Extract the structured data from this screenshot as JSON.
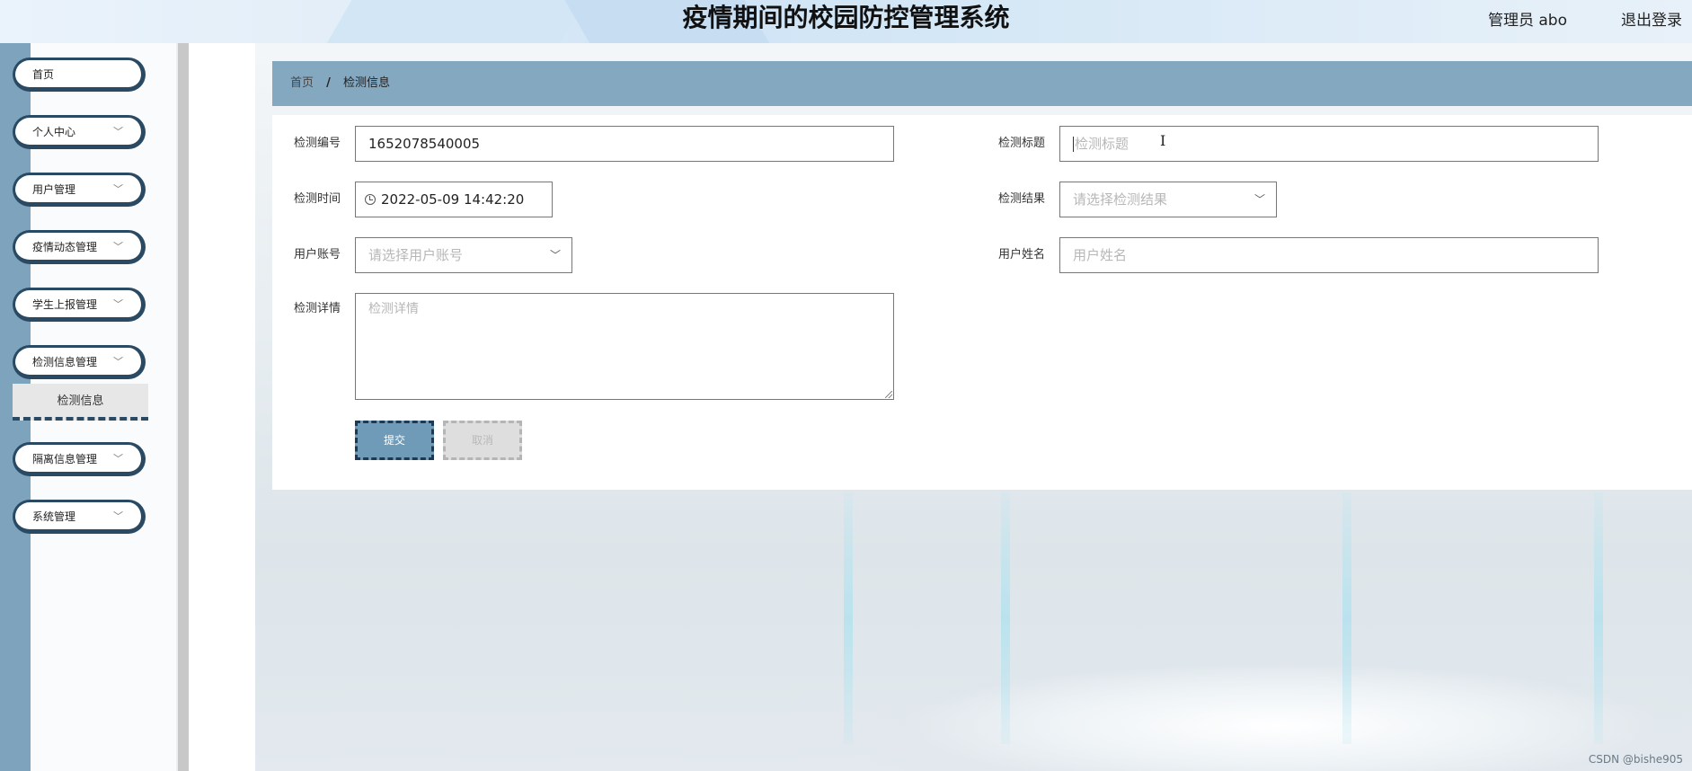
{
  "header": {
    "title": "疫情期间的校园防控管理系统",
    "admin": "管理员 abo",
    "logout": "退出登录"
  },
  "sidebar": {
    "items": [
      {
        "label": "首页",
        "has_children": false
      },
      {
        "label": "个人中心",
        "has_children": true
      },
      {
        "label": "用户管理",
        "has_children": true
      },
      {
        "label": "疫情动态管理",
        "has_children": true
      },
      {
        "label": "学生上报管理",
        "has_children": true
      },
      {
        "label": "检测信息管理",
        "has_children": true
      },
      {
        "label": "隔离信息管理",
        "has_children": true
      },
      {
        "label": "系统管理",
        "has_children": true
      }
    ],
    "active_sub": "检测信息"
  },
  "breadcrumb": {
    "home": "首页",
    "separator": "/",
    "current": "检测信息"
  },
  "form": {
    "test_no": {
      "label": "检测编号",
      "value": "1652078540005"
    },
    "test_title": {
      "label": "检测标题",
      "placeholder": "检测标题"
    },
    "test_time": {
      "label": "检测时间",
      "value": "2022-05-09 14:42:20"
    },
    "test_result": {
      "label": "检测结果",
      "placeholder": "请选择检测结果"
    },
    "user_account": {
      "label": "用户账号",
      "placeholder": "请选择用户账号"
    },
    "user_name": {
      "label": "用户姓名",
      "placeholder": "用户姓名"
    },
    "test_detail": {
      "label": "检测详情",
      "placeholder": "检测详情"
    },
    "submit": "提交",
    "cancel": "取消"
  },
  "watermark": "CSDN @bishe905",
  "colors": {
    "sidebar_accent": "#2a4a64",
    "breadcrumb_bg": "#84a8c0",
    "submit_bg": "#6f9bb8"
  }
}
